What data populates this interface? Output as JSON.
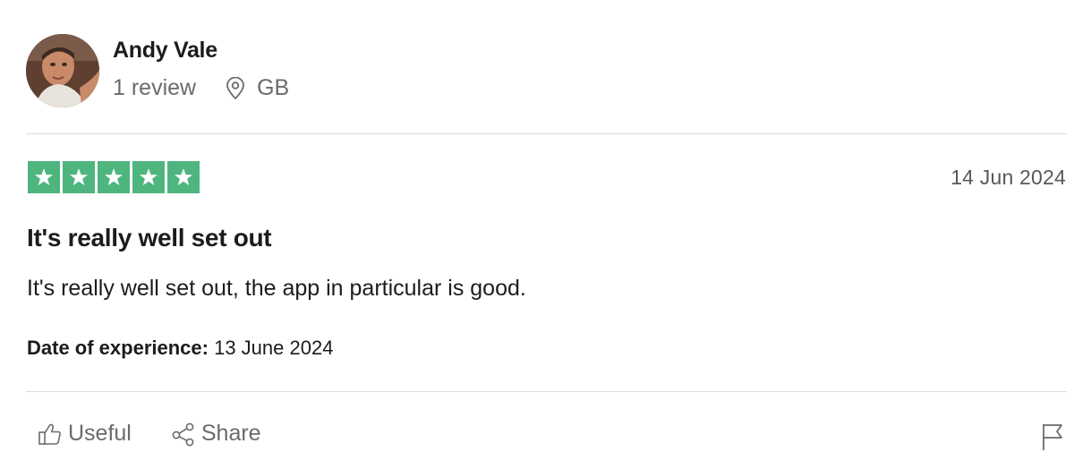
{
  "reviewer": {
    "name": "Andy Vale",
    "review_count": "1 review",
    "country": "GB"
  },
  "review": {
    "rating": 5,
    "rating_max": 5,
    "date": "14 Jun 2024",
    "title": "It's really well set out",
    "body": "It's really well set out, the app in particular is good.",
    "experience_label": "Date of experience:",
    "experience_date": " 13 June 2024"
  },
  "actions": {
    "useful_label": "Useful",
    "share_label": "Share"
  },
  "colors": {
    "star_green": "#4fb57f",
    "muted_text": "#6b6b6b",
    "divider": "#dcdce2"
  },
  "icons": {
    "location": "location-pin-icon",
    "useful": "thumbs-up-icon",
    "share": "share-icon",
    "flag": "flag-icon",
    "star": "star-icon"
  }
}
